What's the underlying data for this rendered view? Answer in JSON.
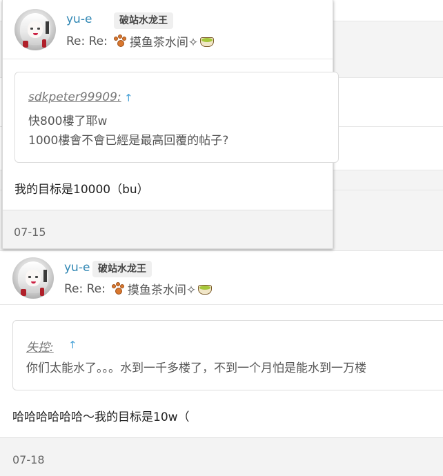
{
  "posts": [
    {
      "username": "yu-e",
      "badge": "破站水龙王",
      "reply_prefix": "Re: Re:",
      "topic_title": "摸鱼茶水间✧",
      "quote": {
        "author": "sdkpeter99909",
        "lines": [
          "快800樓了耶w",
          "1000樓會不會已經是最高回覆的帖子?"
        ]
      },
      "body": "我的目标是10000（bu）",
      "date": "07-15"
    },
    {
      "username": "yu-e",
      "badge": "破站水龙王",
      "reply_prefix": "Re: Re:",
      "topic_title": "摸鱼茶水间✧",
      "quote": {
        "author": "失控",
        "lines": [
          "你们太能水了。。。水到一千多楼了，不到一个月怕是能水到一万楼"
        ]
      },
      "body": "哈哈哈哈哈哈～我的目标是10w（",
      "date": "07-18"
    }
  ],
  "icons": {
    "paw": "paw-emoji-icon",
    "tea": "tea-cup-emoji-icon",
    "jump": "jump-to-quote-icon"
  },
  "colors": {
    "username": "#2f86b3",
    "jump_arrow": "#4aa3d8",
    "footer_bg": "#f3f3f3"
  },
  "symbols": {
    "jump_arrow": "↑",
    "quote_colon": ":"
  }
}
